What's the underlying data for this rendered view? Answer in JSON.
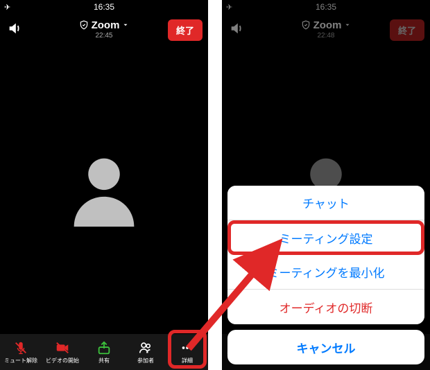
{
  "status": {
    "time": "16:35",
    "airplane": "✈"
  },
  "header": {
    "app": "Zoom",
    "timer_left": "22:45",
    "timer_right": "22:48",
    "end_label": "終了"
  },
  "toolbar": {
    "unmute": "ミュート解除",
    "start_video": "ビデオの開始",
    "share": "共有",
    "participants": "参加者",
    "more": "詳細"
  },
  "sheet": {
    "chat": "チャット",
    "settings": "ミーティング設定",
    "minimize": "ミーティングを最小化",
    "disconnect_audio": "オーディオの切断",
    "cancel": "キャンセル"
  }
}
